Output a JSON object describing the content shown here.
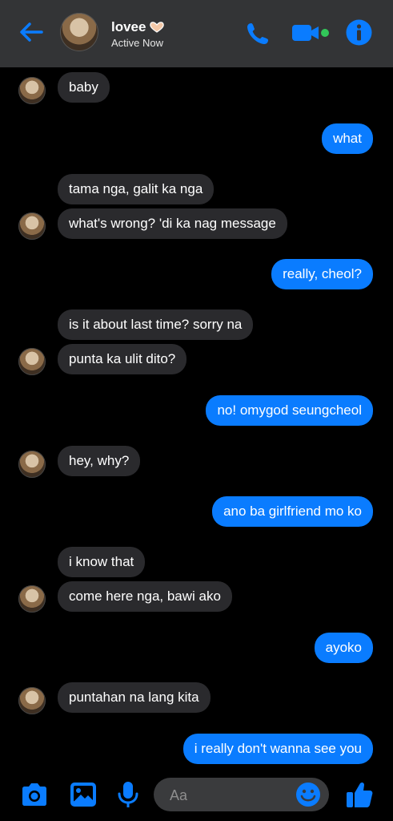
{
  "header": {
    "name": "lovee",
    "status": "Active Now"
  },
  "messages": [
    {
      "side": "in",
      "text": "baby"
    },
    {
      "side": "out",
      "text": "what"
    },
    {
      "side": "in",
      "text": "tama nga, galit ka nga"
    },
    {
      "side": "in",
      "text": "what's wrong? 'di ka nag message"
    },
    {
      "side": "out",
      "text": "really, cheol?"
    },
    {
      "side": "in",
      "text": "is it about last time? sorry na"
    },
    {
      "side": "in",
      "text": "punta ka ulit dito?"
    },
    {
      "side": "out",
      "text": "no! omygod seungcheol"
    },
    {
      "side": "in",
      "text": "hey, why?"
    },
    {
      "side": "out",
      "text": "ano ba girlfriend mo ko"
    },
    {
      "side": "in",
      "text": "i know that"
    },
    {
      "side": "in",
      "text": "come here nga, bawi ako"
    },
    {
      "side": "out",
      "text": "ayoko"
    },
    {
      "side": "in",
      "text": "puntahan na lang kita"
    },
    {
      "side": "out",
      "text": "i really don't wanna see you"
    }
  ],
  "composer": {
    "placeholder": "Aa"
  },
  "colors": {
    "accent": "#0a7cff",
    "incoming_bubble": "#2a2a2d",
    "header_bg": "#333436"
  },
  "icons": [
    "back-arrow-icon",
    "heart-hands-icon",
    "phone-icon",
    "video-camera-icon",
    "info-icon",
    "camera-icon",
    "image-icon",
    "microphone-icon",
    "emoji-icon",
    "thumbs-up-icon"
  ]
}
